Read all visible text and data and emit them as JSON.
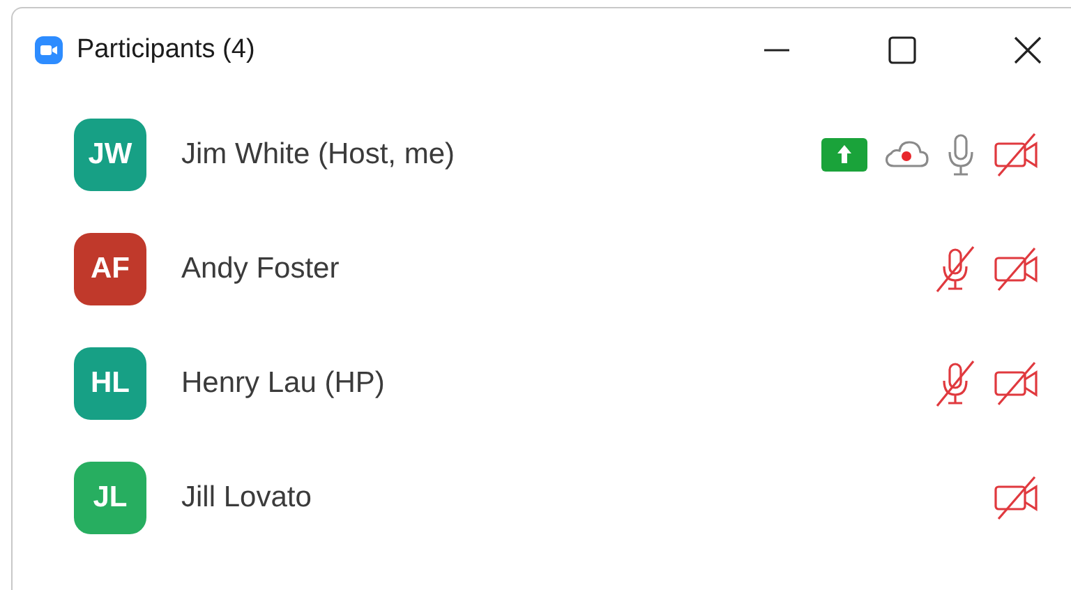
{
  "window": {
    "title": "Participants (4)"
  },
  "participants": [
    {
      "initials": "JW",
      "name": "Jim White (Host, me)",
      "color": "#17a085",
      "sharing": true,
      "recording": true,
      "audio": true,
      "muted": false,
      "video_on": false
    },
    {
      "initials": "AF",
      "name": "Andy Foster",
      "color": "#c0392b",
      "sharing": false,
      "recording": false,
      "audio": true,
      "muted": true,
      "video_on": false
    },
    {
      "initials": "HL",
      "name": "Henry Lau (HP)",
      "color": "#17a085",
      "sharing": false,
      "recording": false,
      "audio": true,
      "muted": true,
      "video_on": false
    },
    {
      "initials": "JL",
      "name": "Jill Lovato",
      "color": "#27ae60",
      "sharing": false,
      "recording": false,
      "audio": false,
      "video_on": false
    }
  ]
}
